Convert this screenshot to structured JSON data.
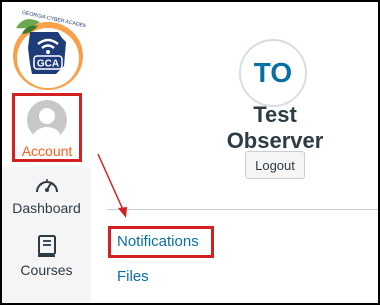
{
  "logo": {
    "text": "GCA",
    "arc_text": "GEORGIA CYBER ACADEMY"
  },
  "sidebar": {
    "account_label": "Account",
    "dashboard_label": "Dashboard",
    "courses_label": "Courses"
  },
  "profile": {
    "initials": "TO",
    "name": "Test Observer",
    "logout_label": "Logout"
  },
  "links": {
    "notifications": "Notifications",
    "files": "Files"
  },
  "colors": {
    "highlight": "#d32020",
    "link": "#0770a3",
    "account_orange": "#ff5e1e"
  }
}
